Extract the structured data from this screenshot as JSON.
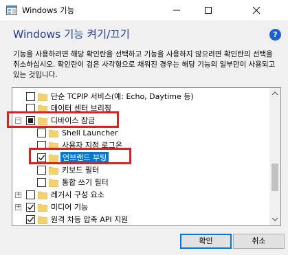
{
  "window": {
    "title": "Windows 기능",
    "minimize_label": "—",
    "close_label": "✕"
  },
  "heading": {
    "title": "Windows 기능 켜기/끄기",
    "help_label": "?"
  },
  "description": "기능을 사용하려면 해당 확인란을 선택하고 기능을 사용하지 않으려면 확인란의 선택을 취소하십시오. 확인란이 검은 사각형으로 채워진 경우는 해당 기능의 일부만이 사용되고 있는 것입니다.",
  "tree": {
    "items": [
      {
        "label": "단순 TCPIP 서비스(예: Echo, Daytime 등)",
        "state": "unchecked",
        "expander": ""
      },
      {
        "label": "데이터 센터 브리징",
        "state": "unchecked",
        "expander": ""
      },
      {
        "label": "디바이스 잠금",
        "state": "partial",
        "expander": "−"
      },
      {
        "label": "Shell Launcher",
        "state": "unchecked",
        "expander": ""
      },
      {
        "label": "사용자 지정 로그온",
        "state": "unchecked",
        "expander": ""
      },
      {
        "label": "언브랜드 부팅",
        "state": "checked",
        "expander": ""
      },
      {
        "label": "키보드 필터",
        "state": "unchecked",
        "expander": ""
      },
      {
        "label": "통합 쓰기 필터",
        "state": "unchecked",
        "expander": ""
      },
      {
        "label": "레거시 구성 요소",
        "state": "unchecked",
        "expander": "+"
      },
      {
        "label": "미디어 기능",
        "state": "checked",
        "expander": "+"
      },
      {
        "label": "원격 차등 압축 API 지원",
        "state": "checked",
        "expander": ""
      }
    ]
  },
  "buttons": {
    "ok_label": "확인",
    "cancel_label": "취소"
  },
  "colors": {
    "heading": "#1f3c99",
    "selection": "#0078d7",
    "highlight": "#e21f1f",
    "folder": "#f5d06e"
  }
}
